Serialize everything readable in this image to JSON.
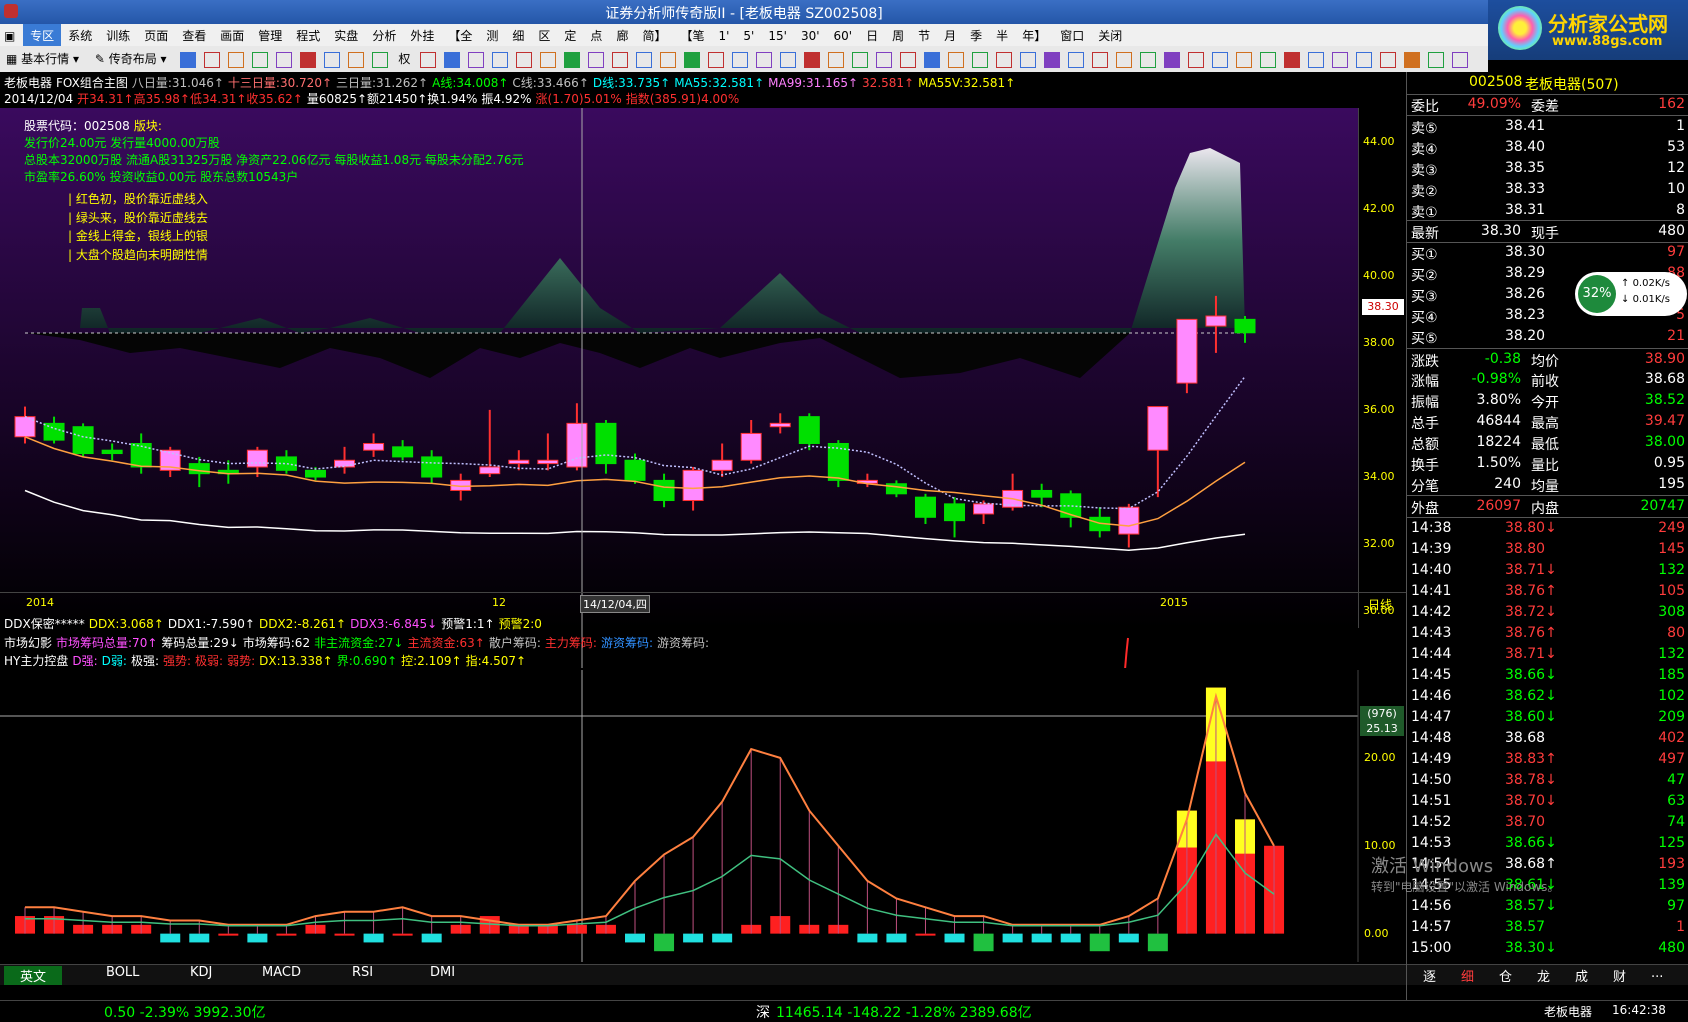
{
  "window": {
    "title": "证券分析师传奇版II - [老板电器 SZ002508]",
    "logo_line1": "分析家公式网",
    "logo_line2": "www.88gs.com"
  },
  "menu": [
    "专区",
    "系统",
    "训练",
    "页面",
    "查看",
    "画面",
    "管理",
    "程式",
    "实盘",
    "分析",
    "外挂",
    "【全",
    "测",
    "细",
    "区",
    "定",
    "点",
    "廊",
    "简】",
    "【笔",
    "1'",
    "5'",
    "15'",
    "30'",
    "60'",
    "日",
    "周",
    "节",
    "月",
    "季",
    "半",
    "年】",
    "窗口",
    "关闭"
  ],
  "toolbar": {
    "basic": "基本行情",
    "layout": "传奇布局",
    "quan": "权"
  },
  "main_chart": {
    "header1": [
      {
        "text": "老板电器",
        "color": "#ffffff"
      },
      {
        "text": "FOX组合主图",
        "color": "#ffffff"
      },
      {
        "text": "八日量:31.046↑",
        "color": "#c0c0c0"
      },
      {
        "text": "十三日量:30.720↑",
        "color": "#ff7070"
      },
      {
        "text": "三日量:31.262↑",
        "color": "#c0c0c0"
      },
      {
        "text": "A线:34.008↑",
        "color": "#00ff00"
      },
      {
        "text": "C线:33.466↑",
        "color": "#c0c0c0"
      },
      {
        "text": "D线:33.735↑",
        "color": "#00ffff"
      },
      {
        "text": "MA55:32.581↑",
        "color": "#00ffff"
      },
      {
        "text": "MA99:31.165↑",
        "color": "#ff80ff"
      },
      {
        "text": "32.581↑",
        "color": "#ff4040"
      },
      {
        "text": "MA55V:32.581↑",
        "color": "#ffff00"
      }
    ],
    "header2": [
      {
        "text": "2014/12/04",
        "color": "#ffffff"
      },
      {
        "text": "开34.31↑高35.98↑低34.31↑收35.62↑",
        "color": "#ff3030"
      },
      {
        "text": "量60825↑额21450↑换1.94%",
        "color": "#ffffff"
      },
      {
        "text": "振4.92%",
        "color": "#ffffff"
      },
      {
        "text": "涨(1.70)5.01%",
        "color": "#ff3030"
      },
      {
        "text": "指数(385.91)4.00%",
        "color": "#ff3030"
      }
    ],
    "info_lines": [
      {
        "text": "股票代码：002508",
        "color": "#ffffff",
        "extra": "版块:",
        "extra_color": "#ffff00"
      },
      {
        "text": "发行价24.00元  发行量4000.00万股",
        "color": "#00ff00"
      },
      {
        "text": "总股本32000万股  流通A股31325万股  净资产22.06亿元  每股收益1.08元  每股未分配2.76元",
        "color": "#00ff00"
      },
      {
        "text": "市盈率26.60%  投资收益0.00元  股东总数10543户",
        "color": "#00ff00"
      }
    ],
    "tips": [
      "| 红色初，股价靠近虚线入",
      "| 绿头来，股价靠近虚线去",
      "| 金线上得金，银线上的银",
      "| 大盘个股趋向末明朗性情"
    ],
    "y_labels": [
      "44.00",
      "42.00",
      "40.00",
      "38.00",
      "36.00",
      "34.00",
      "32.00",
      "30.00"
    ],
    "price_tag": "38.30",
    "x_labels": [
      "2014",
      "12",
      "14/12/04,四",
      "2015"
    ],
    "period": "日线"
  },
  "sub_headers": {
    "ddx": [
      {
        "text": "DDX保密*****",
        "color": "#ffffff"
      },
      {
        "text": "DDX:3.068↑",
        "color": "#ffff00"
      },
      {
        "text": "DDX1:-7.590↑",
        "color": "#ffffff"
      },
      {
        "text": "DDX2:-8.261↑",
        "color": "#ffff00"
      },
      {
        "text": "DDX3:-6.845↓",
        "color": "#ff50ff"
      },
      {
        "text": "预警1:1↑",
        "color": "#ffffff"
      },
      {
        "text": "预警2:0",
        "color": "#ffff00"
      }
    ],
    "market": [
      {
        "text": "市场幻影",
        "color": "#ffffff"
      },
      {
        "text": "市场筹码总量:70↑",
        "color": "#ff50ff"
      },
      {
        "text": "筹码总量:29↓",
        "color": "#ffffff"
      },
      {
        "text": "市场筹码:62",
        "color": "#ffffff"
      },
      {
        "text": "非主流资金:27↓",
        "color": "#00ff00"
      },
      {
        "text": "主流资金:63↑",
        "color": "#ff3030"
      },
      {
        "text": "散户筹码:",
        "color": "#c0c0c0"
      },
      {
        "text": "主力筹码:",
        "color": "#ff3030"
      },
      {
        "text": "游资筹码:",
        "color": "#3090ff"
      },
      {
        "text": "游资筹码:",
        "color": "#c0c0c0"
      }
    ],
    "hy": [
      {
        "text": "HY主力控盘",
        "color": "#ffffff"
      },
      {
        "text": "D强:",
        "color": "#ff50ff"
      },
      {
        "text": "D弱:",
        "color": "#00ffff"
      },
      {
        "text": "极强:",
        "color": "#ffffff"
      },
      {
        "text": "强势:",
        "color": "#ff3030"
      },
      {
        "text": "极弱:",
        "color": "#ff3030"
      },
      {
        "text": "弱势:",
        "color": "#ff3030"
      },
      {
        "text": "DX:13.338↑",
        "color": "#ffff00"
      },
      {
        "text": "界:0.690↑",
        "color": "#00ff00"
      },
      {
        "text": "控:2.109↑",
        "color": "#ffff00"
      },
      {
        "text": "指:4.507↑",
        "color": "#ffff00"
      }
    ],
    "y_labels": [
      "20.00",
      "10.00",
      "0.00"
    ],
    "crosshair_tag1": "(976)",
    "crosshair_tag2": "25.13"
  },
  "bottom_tabs": {
    "lang": "英文",
    "tabs": [
      "BOLL",
      "KDJ",
      "MACD",
      "RSI",
      "DMI"
    ]
  },
  "right_panel": {
    "code": "002508",
    "name": "老板电器(507)",
    "weibi_label": "委比",
    "weibi_value": "49.09%",
    "weicha_label": "委差",
    "weicha_value": "162",
    "asks": [
      {
        "label": "卖⑤",
        "price": "38.41",
        "vol": "1"
      },
      {
        "label": "卖④",
        "price": "38.40",
        "vol": "53"
      },
      {
        "label": "卖③",
        "price": "38.35",
        "vol": "12"
      },
      {
        "label": "卖②",
        "price": "38.33",
        "vol": "10"
      },
      {
        "label": "卖①",
        "price": "38.31",
        "vol": "8"
      }
    ],
    "last_label": "最新",
    "last_value": "38.30",
    "xianshou_label": "现手",
    "xianshou_value": "480",
    "bids": [
      {
        "label": "买①",
        "price": "38.30",
        "vol": "97"
      },
      {
        "label": "买②",
        "price": "38.29",
        "vol": "88"
      },
      {
        "label": "买③",
        "price": "38.26",
        "vol": "10"
      },
      {
        "label": "买④",
        "price": "38.23",
        "vol": "5"
      },
      {
        "label": "买⑤",
        "price": "38.20",
        "vol": "21"
      }
    ],
    "speed_badge": "32%",
    "speed_up": "0.02K/s",
    "speed_down": "0.01K/s",
    "stats": [
      {
        "l1": "涨跌",
        "v1": "-0.38",
        "c1": "#00ff00",
        "l2": "均价",
        "v2": "38.90",
        "c2": "#ff3c3c"
      },
      {
        "l1": "涨幅",
        "v1": "-0.98%",
        "c1": "#00ff00",
        "l2": "前收",
        "v2": "38.68",
        "c2": "#ffffff"
      },
      {
        "l1": "振幅",
        "v1": "3.80%",
        "c1": "#ffffff",
        "l2": "今开",
        "v2": "38.52",
        "c2": "#00ff00"
      },
      {
        "l1": "总手",
        "v1": "46844",
        "c1": "#ffffff",
        "l2": "最高",
        "v2": "39.47",
        "c2": "#ff3c3c"
      },
      {
        "l1": "总额",
        "v1": "18224",
        "c1": "#ffffff",
        "l2": "最低",
        "v2": "38.00",
        "c2": "#00ff00"
      },
      {
        "l1": "换手",
        "v1": "1.50%",
        "c1": "#ffffff",
        "l2": "量比",
        "v2": "0.95",
        "c2": "#ffffff"
      },
      {
        "l1": "分笔",
        "v1": "240",
        "c1": "#ffffff",
        "l2": "均量",
        "v2": "195",
        "c2": "#ffffff"
      },
      {
        "l1": "外盘",
        "v1": "26097",
        "c1": "#ff3c3c",
        "l2": "内盘",
        "v2": "20747",
        "c2": "#00ff00"
      }
    ],
    "ticks": [
      {
        "t": "14:38",
        "p": "38.80↓",
        "pc": "#ff3c3c",
        "v": "249",
        "vc": "#ff3c3c"
      },
      {
        "t": "14:39",
        "p": "38.80",
        "pc": "#ff3c3c",
        "v": "145",
        "vc": "#ff3c3c"
      },
      {
        "t": "14:40",
        "p": "38.71↓",
        "pc": "#ff3c3c",
        "v": "132",
        "vc": "#00ff00"
      },
      {
        "t": "14:41",
        "p": "38.76↑",
        "pc": "#ff3c3c",
        "v": "105",
        "vc": "#ff3c3c"
      },
      {
        "t": "14:42",
        "p": "38.72↓",
        "pc": "#ff3c3c",
        "v": "308",
        "vc": "#00ff00"
      },
      {
        "t": "14:43",
        "p": "38.76↑",
        "pc": "#ff3c3c",
        "v": "80",
        "vc": "#ff3c3c"
      },
      {
        "t": "14:44",
        "p": "38.71↓",
        "pc": "#ff3c3c",
        "v": "132",
        "vc": "#00ff00"
      },
      {
        "t": "14:45",
        "p": "38.66↓",
        "pc": "#00ff00",
        "v": "185",
        "vc": "#00ff00"
      },
      {
        "t": "14:46",
        "p": "38.62↓",
        "pc": "#00ff00",
        "v": "102",
        "vc": "#00ff00"
      },
      {
        "t": "14:47",
        "p": "38.60↓",
        "pc": "#00ff00",
        "v": "209",
        "vc": "#00ff00"
      },
      {
        "t": "14:48",
        "p": "38.68",
        "pc": "#ffffff",
        "v": "402",
        "vc": "#ff3c3c"
      },
      {
        "t": "14:49",
        "p": "38.83↑",
        "pc": "#ff3c3c",
        "v": "497",
        "vc": "#ff3c3c"
      },
      {
        "t": "14:50",
        "p": "38.78↓",
        "pc": "#ff3c3c",
        "v": "47",
        "vc": "#00ff00"
      },
      {
        "t": "14:51",
        "p": "38.70↓",
        "pc": "#ff3c3c",
        "v": "63",
        "vc": "#00ff00"
      },
      {
        "t": "14:52",
        "p": "38.70",
        "pc": "#ff3c3c",
        "v": "74",
        "vc": "#00ff00"
      },
      {
        "t": "14:53",
        "p": "38.66↓",
        "pc": "#00ff00",
        "v": "125",
        "vc": "#00ff00"
      },
      {
        "t": "14:54",
        "p": "38.68↑",
        "pc": "#ffffff",
        "v": "193",
        "vc": "#ff3c3c"
      },
      {
        "t": "14:55",
        "p": "38.61↓",
        "pc": "#00ff00",
        "v": "139",
        "vc": "#00ff00"
      },
      {
        "t": "14:56",
        "p": "38.57↓",
        "pc": "#00ff00",
        "v": "97",
        "vc": "#00ff00"
      },
      {
        "t": "14:57",
        "p": "38.57",
        "pc": "#00ff00",
        "v": "1",
        "vc": "#ff3c3c"
      },
      {
        "t": "15:00",
        "p": "38.30↓",
        "pc": "#00ff00",
        "v": "480",
        "vc": "#00ff00"
      }
    ],
    "watermark1": "激活 Windows",
    "watermark2": "转到\"电脑设置\"以激活 Windows。",
    "bottom_tabs": [
      "逐",
      "细",
      "仓",
      "龙",
      "成",
      "财",
      "..."
    ]
  },
  "status": {
    "left": "0.50  -2.39%  3992.30亿",
    "shen": "深",
    "shen_value": "11465.14  -148.22  -1.28%  2389.68亿",
    "stock": "老板电器",
    "time": "16:42:38"
  },
  "chart_data": {
    "type": "candlestick",
    "ylim": [
      29.5,
      45.0
    ],
    "candles": [
      [
        35.2,
        36.1,
        35.0,
        35.8
      ],
      [
        35.6,
        35.8,
        35.0,
        35.1
      ],
      [
        35.5,
        35.6,
        34.6,
        34.7
      ],
      [
        34.8,
        35.0,
        34.5,
        34.7
      ],
      [
        35.0,
        35.3,
        34.1,
        34.3
      ],
      [
        34.2,
        34.9,
        34.0,
        34.8
      ],
      [
        34.4,
        34.6,
        33.7,
        34.1
      ],
      [
        34.2,
        34.5,
        33.8,
        34.1
      ],
      [
        34.3,
        34.9,
        34.0,
        34.8
      ],
      [
        34.6,
        34.8,
        34.1,
        34.2
      ],
      [
        34.2,
        34.3,
        33.9,
        34.0
      ],
      [
        34.3,
        34.9,
        34.1,
        34.5
      ],
      [
        34.8,
        35.3,
        34.6,
        35.0
      ],
      [
        34.9,
        35.1,
        34.5,
        34.6
      ],
      [
        34.6,
        34.8,
        33.8,
        34.0
      ],
      [
        33.6,
        34.1,
        33.3,
        33.9
      ],
      [
        34.1,
        36.0,
        34.0,
        34.3
      ],
      [
        34.4,
        34.8,
        34.2,
        34.5
      ],
      [
        34.4,
        35.3,
        34.2,
        34.5
      ],
      [
        34.3,
        36.2,
        34.2,
        35.6
      ],
      [
        35.6,
        35.7,
        34.1,
        34.4
      ],
      [
        34.5,
        34.7,
        33.8,
        33.9
      ],
      [
        33.9,
        34.1,
        33.1,
        33.3
      ],
      [
        33.3,
        34.3,
        33.0,
        34.2
      ],
      [
        34.2,
        35.0,
        34.0,
        34.5
      ],
      [
        34.5,
        35.7,
        34.4,
        35.3
      ],
      [
        35.5,
        35.9,
        35.3,
        35.6
      ],
      [
        35.8,
        35.9,
        34.8,
        35.0
      ],
      [
        35.0,
        35.1,
        33.7,
        33.9
      ],
      [
        33.9,
        34.1,
        33.7,
        33.9
      ],
      [
        33.8,
        33.9,
        33.4,
        33.5
      ],
      [
        33.4,
        33.5,
        32.6,
        32.8
      ],
      [
        33.2,
        33.4,
        32.2,
        32.7
      ],
      [
        32.9,
        33.3,
        32.6,
        33.2
      ],
      [
        33.1,
        34.1,
        33.0,
        33.6
      ],
      [
        33.6,
        33.8,
        33.1,
        33.4
      ],
      [
        33.5,
        33.6,
        32.5,
        32.8
      ],
      [
        32.8,
        33.1,
        32.2,
        32.4
      ],
      [
        32.3,
        33.2,
        31.9,
        33.1
      ],
      [
        34.8,
        36.1,
        33.4,
        36.1
      ],
      [
        36.8,
        38.0,
        36.5,
        38.7
      ],
      [
        38.5,
        39.4,
        37.7,
        38.8
      ],
      [
        38.7,
        38.8,
        38.0,
        38.3
      ]
    ],
    "sub_bars": [
      2,
      2,
      1,
      1,
      1,
      -1,
      -1,
      0,
      -1,
      0,
      1,
      0,
      -1,
      0,
      -1,
      1,
      2,
      1,
      1,
      1,
      1,
      -1,
      -2,
      -1,
      -1,
      1,
      2,
      1,
      1,
      -1,
      -1,
      0,
      -1,
      -2,
      -1,
      -1,
      -1,
      -2,
      -1,
      -2,
      14,
      28,
      13,
      10
    ],
    "sub_line": [
      3,
      3,
      2.5,
      2,
      2,
      1.5,
      1.5,
      1,
      1,
      1,
      2,
      2.5,
      2.5,
      3,
      2,
      2,
      1.5,
      1,
      1,
      1.5,
      2,
      6,
      9,
      11,
      15,
      21,
      20,
      14,
      10,
      6,
      4,
      3,
      2,
      2,
      1,
      1,
      1,
      1,
      2,
      4,
      13,
      27,
      16,
      10
    ],
    "sub_ylim": [
      -3,
      30
    ]
  }
}
